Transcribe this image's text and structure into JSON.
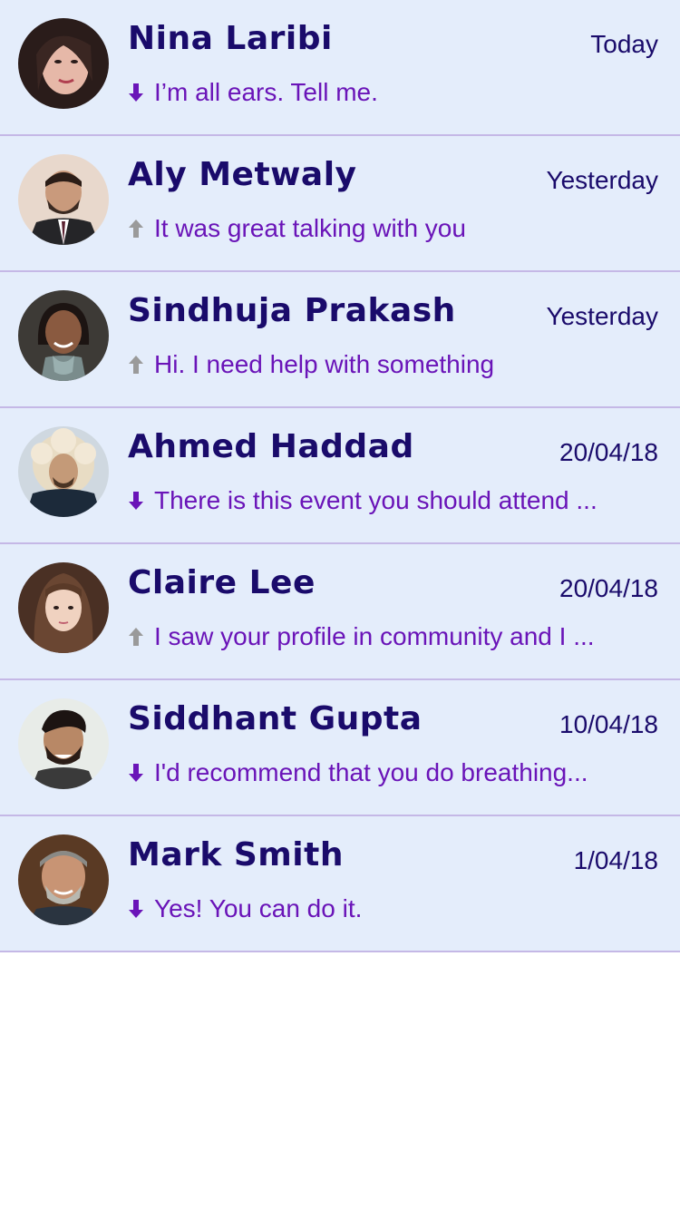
{
  "colors": {
    "row_background": "#e4edfb",
    "separator": "#c5b8e6",
    "name": "#1a0b6b",
    "preview": "#6a14b8",
    "arrow_received": "#6a14b8",
    "arrow_sent": "#9a9a9a"
  },
  "conversations": [
    {
      "name": "Nina Laribi",
      "date": "Today",
      "preview": "I’m all ears. Tell me.",
      "direction": "received",
      "icon": "arrow-down-icon"
    },
    {
      "name": "Aly Metwaly",
      "date": "Yesterday",
      "preview": "It was great talking with you",
      "direction": "sent",
      "icon": "arrow-up-icon"
    },
    {
      "name": "Sindhuja Prakash",
      "date": "Yesterday",
      "preview": "Hi. I need help with something",
      "direction": "sent",
      "icon": "arrow-up-icon"
    },
    {
      "name": "Ahmed Haddad",
      "date": "20/04/18",
      "preview": "There is this event you should attend ...",
      "direction": "received",
      "icon": "arrow-down-icon"
    },
    {
      "name": "Claire Lee",
      "date": "20/04/18",
      "preview": "I saw your profile in community and I ...",
      "direction": "sent",
      "icon": "arrow-up-icon"
    },
    {
      "name": "Siddhant Gupta",
      "date": "10/04/18",
      "preview": "I'd recommend that you do breathing...",
      "direction": "received",
      "icon": "arrow-down-icon"
    },
    {
      "name": "Mark Smith",
      "date": "1/04/18",
      "preview": "Yes! You can do it.",
      "direction": "received",
      "icon": "arrow-down-icon"
    }
  ]
}
